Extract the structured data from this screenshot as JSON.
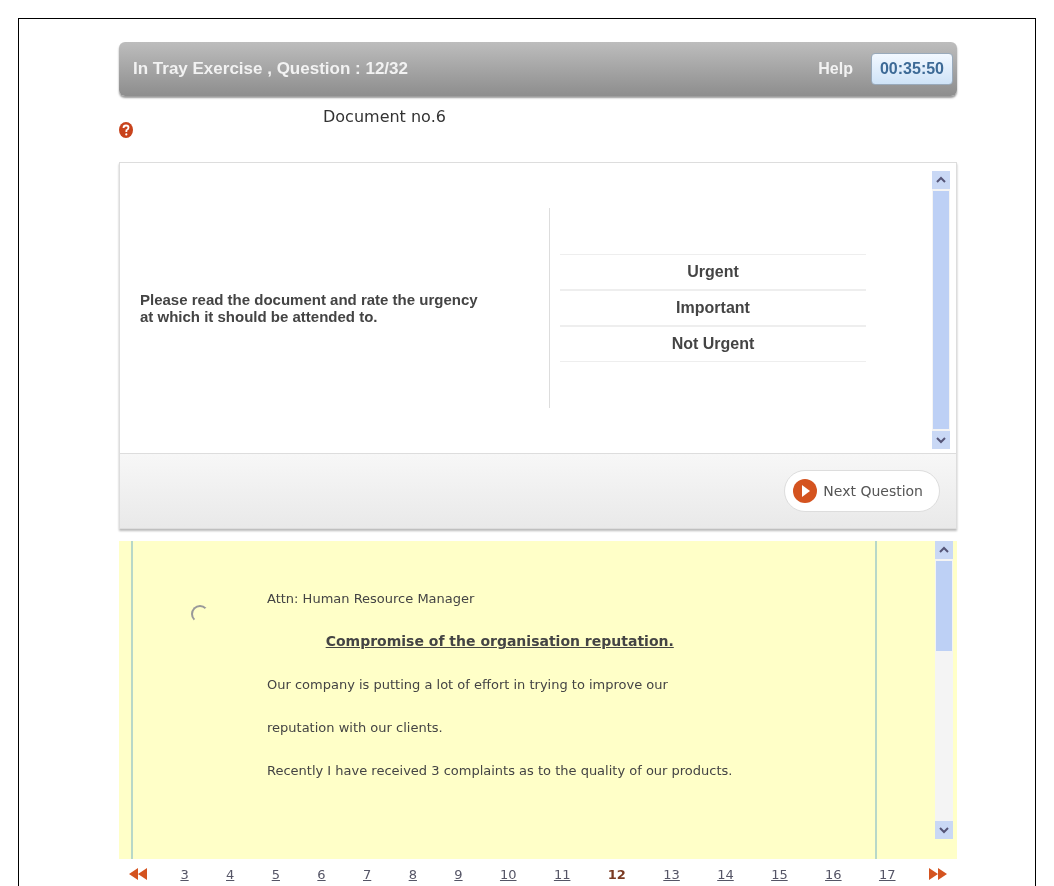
{
  "header": {
    "title": "In Tray Exercise , Question : 12/32",
    "help": "Help",
    "timer": "00:35:50"
  },
  "document_title": "Document no.6",
  "question": {
    "prompt": "Please read the document and rate the urgency at which it should be attended to.",
    "options": [
      {
        "label": "Urgent",
        "selected": false
      },
      {
        "label": "Important",
        "selected": false
      },
      {
        "label": "Not Urgent",
        "selected": false
      }
    ]
  },
  "next_button": "Next Question",
  "document": {
    "selected": false,
    "attn": "Attn: Human Resource Manager",
    "heading": "Compromise of the organisation reputation.",
    "lines": [
      "Our company is putting a lot of effort in trying to improve our",
      "reputation with our clients.",
      "Recently I have received 3 complaints as to the quality of our products."
    ]
  },
  "pager": [
    {
      "label": "3",
      "selected": false
    },
    {
      "label": "4",
      "selected": false
    },
    {
      "label": "5",
      "selected": false
    },
    {
      "label": "6",
      "selected": false
    },
    {
      "label": "7",
      "selected": false
    },
    {
      "label": "8",
      "selected": false
    },
    {
      "label": "9",
      "selected": false
    },
    {
      "label": "10",
      "selected": false
    },
    {
      "label": "11",
      "selected": false
    },
    {
      "label": "12",
      "selected": true
    },
    {
      "label": "13",
      "selected": false
    },
    {
      "label": "14",
      "selected": false
    },
    {
      "label": "15",
      "selected": false
    },
    {
      "label": "16",
      "selected": false
    },
    {
      "label": "17",
      "selected": false
    }
  ]
}
